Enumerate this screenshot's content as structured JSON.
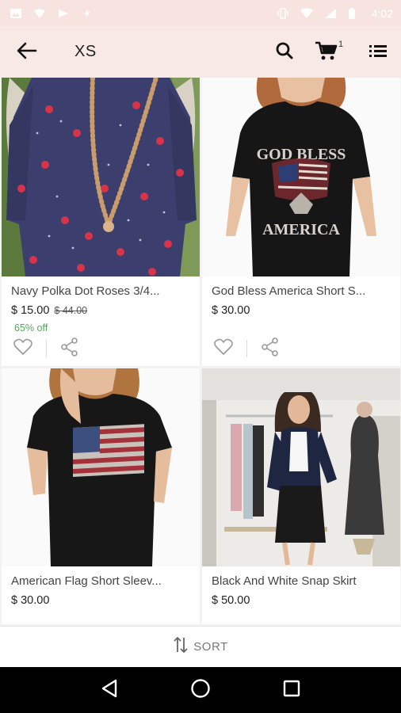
{
  "status_bar": {
    "time": "4:02"
  },
  "app_bar": {
    "title": "XS",
    "cart_count": "1"
  },
  "products": [
    {
      "name": "Navy Polka Dot Roses 3/4...",
      "price": "$ 15.00",
      "old_price": "$ 44.00",
      "discount": "65% off"
    },
    {
      "name": "God Bless America Short S...",
      "price": "$ 30.00"
    },
    {
      "name": "American Flag Short Sleev...",
      "price": "$ 30.00"
    },
    {
      "name": "Black And White Snap Skirt",
      "price": "$ 50.00"
    }
  ],
  "shirt_print": {
    "line1": "GOD BLESS",
    "line2": "AMERICA"
  },
  "sort_bar": {
    "label": "SORT"
  },
  "icons": {
    "back": "arrow-left-icon",
    "search": "search-icon",
    "cart": "cart-icon",
    "list": "list-icon",
    "heart": "heart-outline-icon",
    "share": "share-icon",
    "sort": "sort-icon",
    "nav_back": "triangle-back-icon",
    "nav_home": "circle-home-icon",
    "nav_recents": "square-recents-icon"
  },
  "colors": {
    "app_bar_bg": "#f9e9e6",
    "discount": "#4caf50",
    "nav_bg": "#000000"
  }
}
